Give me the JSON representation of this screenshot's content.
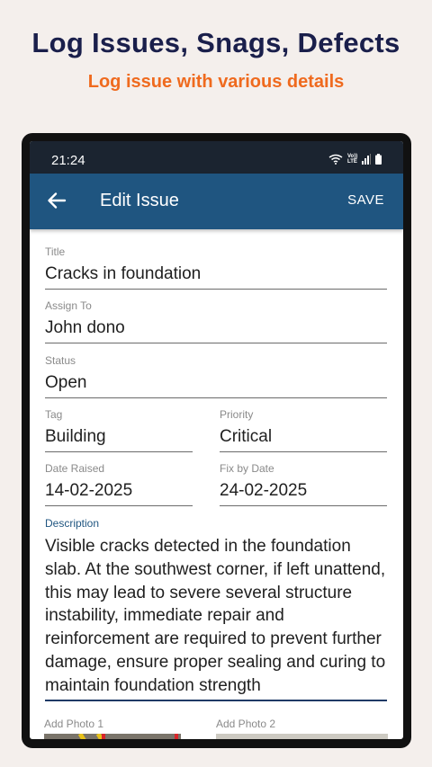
{
  "promo": {
    "title": "Log Issues, Snags, Defects",
    "subtitle": "Log issue with various details"
  },
  "status_bar": {
    "time": "21:24",
    "network_label": "Vo))\nLTE"
  },
  "app_bar": {
    "title": "Edit Issue",
    "save_label": "SAVE"
  },
  "form": {
    "title": {
      "label": "Title",
      "value": "Cracks in foundation"
    },
    "assign_to": {
      "label": "Assign To",
      "value": "John dono"
    },
    "status": {
      "label": "Status",
      "value": "Open"
    },
    "tag": {
      "label": "Tag",
      "value": "Building"
    },
    "priority": {
      "label": "Priority",
      "value": "Critical"
    },
    "date_raised": {
      "label": "Date Raised",
      "value": "14-02-2025"
    },
    "fix_by_date": {
      "label": "Fix by Date",
      "value": "24-02-2025"
    },
    "description": {
      "label": "Description",
      "value": "Visible cracks detected in the foundation slab. At the southwest corner, if left unattend, this may lead to severe several structure instability, immediate repair and reinforcement are required to prevent further damage, ensure proper sealing and curing to maintain foundation strength"
    }
  },
  "photos": {
    "photo1_label": "Add Photo 1",
    "photo2_label": "Add Photo 2"
  },
  "colors": {
    "app_bar": "#1f5580",
    "status_bar": "#1b2430",
    "promo_title": "#1a1f4b",
    "promo_subtitle": "#ef6a1e",
    "focus_underline": "#1f3a66"
  }
}
